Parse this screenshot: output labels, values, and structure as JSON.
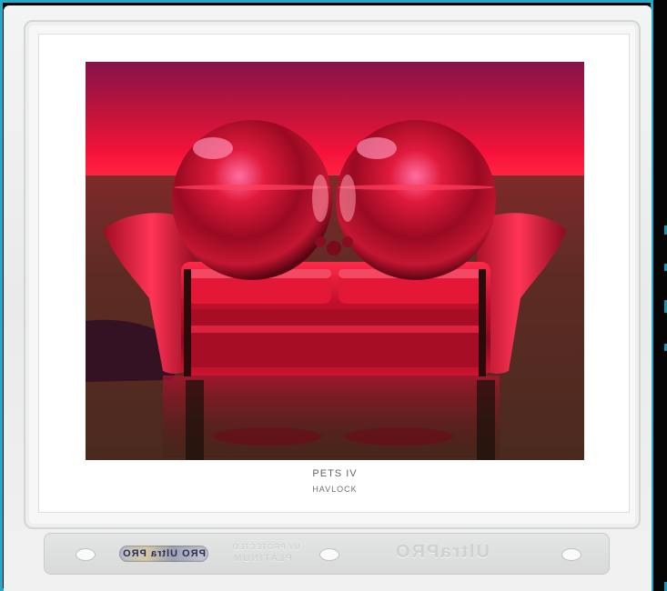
{
  "artwork": {
    "title": "PETS IV",
    "artist": "HAVLOCK"
  },
  "sleeve": {
    "badge_text": "PRO Ultra PRO",
    "ghost_small": "UV PROTECTED",
    "ghost_mid": "PLATINUM",
    "ghost_logo": "UltraPRO"
  },
  "colors": {
    "cyan_edge": "#21a9c9",
    "sky_top": "#8a1646",
    "horizon": "#ff1033",
    "floor": "#5a2a22",
    "sphere": "#e0102b",
    "sofa": "#c8102a"
  },
  "icons": {
    "hole": "punch-hole-icon"
  }
}
